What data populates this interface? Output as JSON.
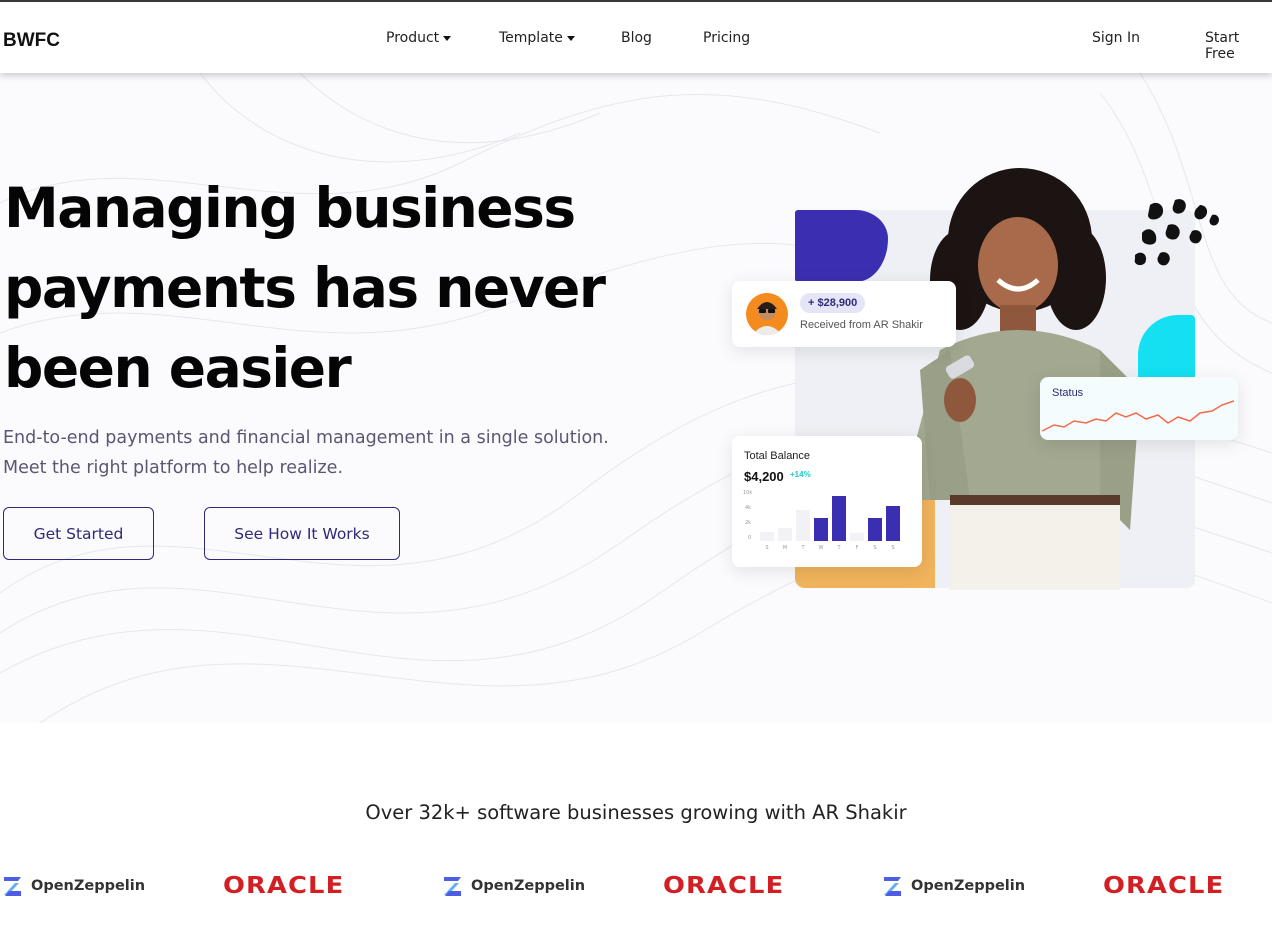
{
  "brand": "BWFC",
  "nav": {
    "product": "Product",
    "template": "Template",
    "blog": "Blog",
    "pricing": "Pricing",
    "sign_in": "Sign In",
    "start_free": "Start Free"
  },
  "hero": {
    "headline_line1": "Managing business",
    "headline_line2": "payments has never",
    "headline_line3": "been easier",
    "subtext": "End-to-end payments and financial management in a single solution. Meet the right platform to help realize.",
    "get_started": "Get Started",
    "see_how": "See How It Works"
  },
  "illustration": {
    "received_amount": "+ $28,900",
    "received_text": "Received from AR Shakir",
    "status_label": "Status",
    "balance_title": "Total Balance",
    "balance_value": "$4,200",
    "balance_delta": "+14%",
    "chart_ticks": [
      "10k",
      "4k",
      "2k",
      "0"
    ],
    "chart_days": [
      "S",
      "M",
      "T",
      "W",
      "T",
      "F",
      "S",
      "S"
    ],
    "colors": {
      "navy": "#3a2fb1",
      "cyan": "#14e0f2",
      "orange": "#f1b35c"
    }
  },
  "logos": {
    "heading": "Over 32k+ software businesses growing with AR Shakir",
    "items": [
      {
        "name": "OpenZeppelin",
        "icon": "openzeppelin-logo-icon"
      },
      {
        "name": "ORACLE",
        "icon": "oracle-logo"
      },
      {
        "name": "OpenZeppelin",
        "icon": "openzeppelin-logo-icon"
      },
      {
        "name": "ORACLE",
        "icon": "oracle-logo"
      },
      {
        "name": "OpenZeppelin",
        "icon": "openzeppelin-logo-icon"
      },
      {
        "name": "ORACLE",
        "icon": "oracle-logo"
      }
    ]
  }
}
